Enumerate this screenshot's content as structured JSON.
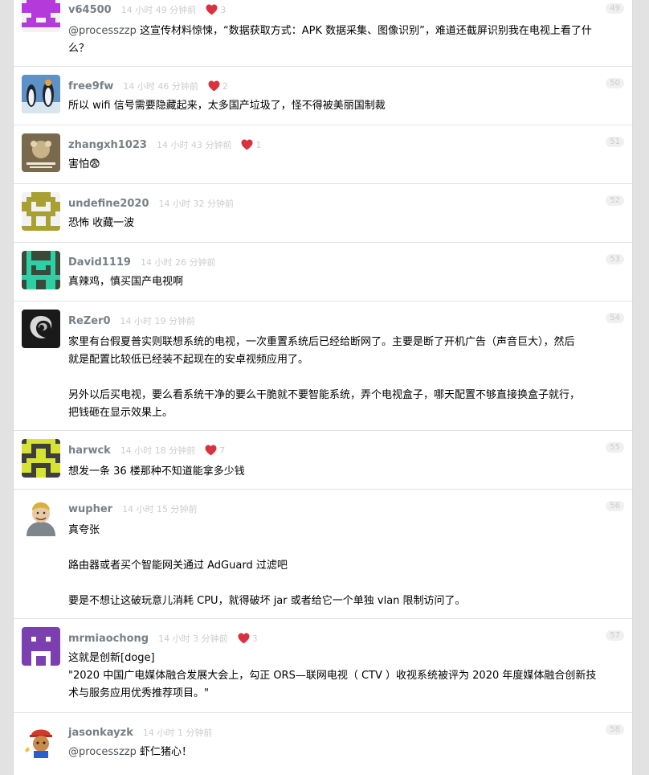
{
  "replies": [
    {
      "username": "v64500",
      "time": "14 小时 49 分钟前",
      "likes": "3",
      "floor": "49",
      "avatar_color": "#b43ad9",
      "content": [
        {
          "mention": "@processzzp",
          "text": " 这宣传材料惊悚，“数据获取方式：APK 数据采集、图像识别”，难道还截屏识别我在电视上看了什"
        },
        {
          "text": "么？"
        }
      ]
    },
    {
      "username": "free9fw",
      "time": "14 小时 46 分钟前",
      "likes": "2",
      "floor": "50",
      "avatar_color": "#4a7eb6",
      "content": [
        {
          "text": "所以 wifi 信号需要隐藏起来，太多国产垃圾了，怪不得被美丽国制裁"
        }
      ]
    },
    {
      "username": "zhangxh1023",
      "time": "14 小时 43 分钟前",
      "likes": "1",
      "floor": "51",
      "avatar_color": "#6f5e43",
      "content": [
        {
          "text": "害怕😨"
        }
      ]
    },
    {
      "username": "undefine2020",
      "time": "14 小时 32 分钟前",
      "likes": "",
      "floor": "52",
      "avatar_color": "#a8a032",
      "content": [
        {
          "text": "恐怖 收藏一波"
        }
      ]
    },
    {
      "username": "David1119",
      "time": "14 小时 26 分钟前",
      "likes": "",
      "floor": "53",
      "avatar_color": "#2ecfa5",
      "content": [
        {
          "text": "真辣鸡，慎买国产电视啊"
        }
      ]
    },
    {
      "username": "ReZer0",
      "time": "14 小时 19 分钟前",
      "likes": "",
      "floor": "54",
      "avatar_color": "#222222",
      "content": [
        {
          "text": "家里有台假夏普实则联想系统的电视，一次重置系统后已经给断网了。主要是断了开机广告（声音巨大），然后"
        },
        {
          "text": "就是配置比较低已经装不起现在的安卓视频应用了。"
        },
        {
          "gap": true
        },
        {
          "text": "另外以后买电视，要么看系统干净的要么干脆就不要智能系统，弄个电视盒子，哪天配置不够直接换盒子就行，"
        },
        {
          "text": "把钱砸在显示效果上。"
        }
      ]
    },
    {
      "username": "harwck",
      "time": "14 小时 18 分钟前",
      "likes": "7",
      "floor": "55",
      "avatar_color": "#d7e332",
      "content": [
        {
          "text": "想发一条 36 楼那种不知道能拿多少钱"
        }
      ]
    },
    {
      "username": "wupher",
      "time": "14 小时 15 分钟前",
      "likes": "",
      "floor": "56",
      "avatar_color": "#9aa3ad",
      "content": [
        {
          "text": "真夸张"
        },
        {
          "gap": true
        },
        {
          "text": "路由器或者买个智能网关通过 AdGuard 过滤吧"
        },
        {
          "gap": true
        },
        {
          "text": "要是不想让这破玩意儿消耗 CPU，就得破坏 jar 或者给它一个单独 vlan 限制访问了。"
        }
      ]
    },
    {
      "username": "mrmiaochong",
      "time": "14 小时 3 分钟前",
      "likes": "3",
      "floor": "57",
      "avatar_color": "#7b3fb0",
      "content": [
        {
          "text": "这就是创新[doge]"
        },
        {
          "text": "\"2020 中国广电媒体融合发展大会上，勾正 ORS—联网电视（ CTV ）收视系统被评为 2020 年度媒体融合创新技"
        },
        {
          "text": "术与服务应用优秀推荐项目。\""
        }
      ]
    },
    {
      "username": "jasonkayzk",
      "time": "14 小时 1 分钟前",
      "likes": "",
      "floor": "58",
      "avatar_color": "#d43a2a",
      "content": [
        {
          "mention": "@processzzp",
          "text": " 虾仁猪心！"
        }
      ]
    }
  ]
}
